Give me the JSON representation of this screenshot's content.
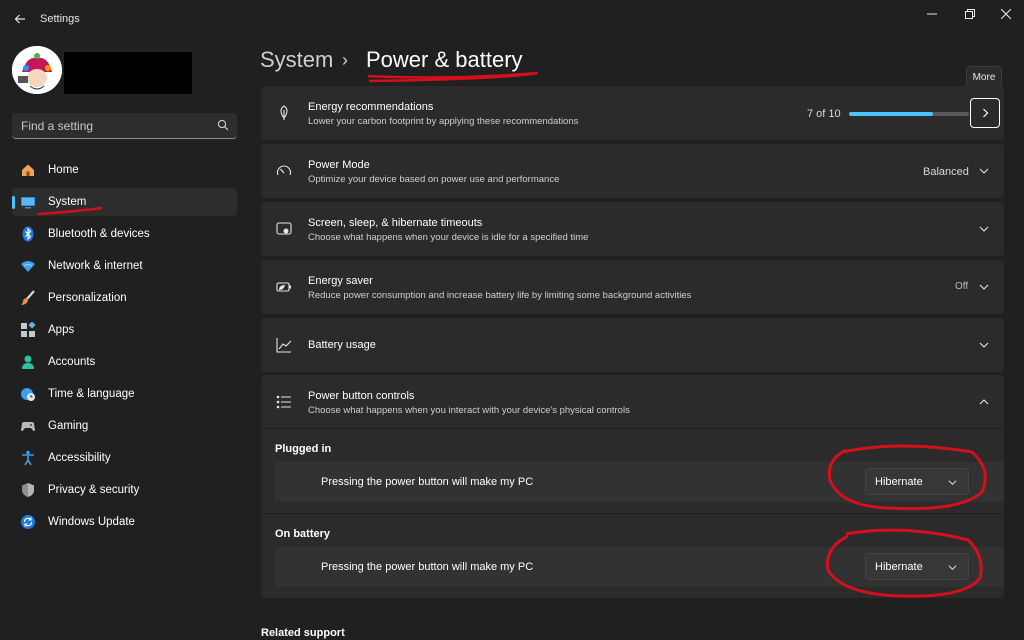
{
  "window": {
    "title": "Settings",
    "controls": [
      "minimize-icon",
      "maximize-icon",
      "close-icon"
    ]
  },
  "search": {
    "placeholder": "Find a setting"
  },
  "sidebar": {
    "items": [
      {
        "label": "Home",
        "icon": "home-icon"
      },
      {
        "label": "System",
        "icon": "system-icon",
        "active": true
      },
      {
        "label": "Bluetooth & devices",
        "icon": "bluetooth-icon"
      },
      {
        "label": "Network & internet",
        "icon": "wifi-icon"
      },
      {
        "label": "Personalization",
        "icon": "brush-icon"
      },
      {
        "label": "Apps",
        "icon": "apps-icon"
      },
      {
        "label": "Accounts",
        "icon": "accounts-icon"
      },
      {
        "label": "Time & language",
        "icon": "globe-clock-icon"
      },
      {
        "label": "Gaming",
        "icon": "gamepad-icon"
      },
      {
        "label": "Accessibility",
        "icon": "accessibility-icon"
      },
      {
        "label": "Privacy & security",
        "icon": "shield-icon"
      },
      {
        "label": "Windows Update",
        "icon": "update-icon"
      }
    ]
  },
  "breadcrumb": {
    "parent": "System",
    "separator": "›",
    "current": "Power & battery"
  },
  "tooltip": {
    "text": "More"
  },
  "cards": {
    "energy_recommendations": {
      "title": "Energy recommendations",
      "description": "Lower your carbon footprint by applying these recommendations",
      "progress_text": "7 of 10",
      "progress_fraction": 0.7
    },
    "power_mode": {
      "title": "Power Mode",
      "description": "Optimize your device based on power use and performance",
      "value": "Balanced"
    },
    "timeouts": {
      "title": "Screen, sleep, & hibernate timeouts",
      "description": "Choose what happens when your device is idle for a specified time"
    },
    "energy_saver": {
      "title": "Energy saver",
      "description": "Reduce power consumption and increase battery life by limiting some background activities",
      "value": "Off"
    },
    "battery_usage": {
      "title": "Battery usage"
    },
    "power_button": {
      "title": "Power button controls",
      "description": "Choose what happens when you interact with your device's physical controls",
      "plugged_in": {
        "heading": "Plugged in",
        "label": "Pressing the power button will make my PC",
        "value": "Hibernate"
      },
      "on_battery": {
        "heading": "On battery",
        "label": "Pressing the power button will make my PC",
        "value": "Hibernate"
      }
    }
  },
  "related": {
    "heading": "Related support"
  },
  "colors": {
    "accent": "#4cc2ff",
    "background": "#202020",
    "card": "#2b2b2b",
    "annotation": "#d4101c"
  }
}
